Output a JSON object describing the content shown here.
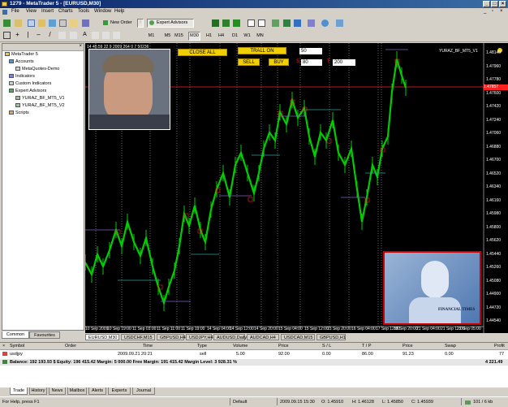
{
  "window": {
    "title": "1279 - MetaTrader 5 - [EURUSD,M30]"
  },
  "menu": [
    "File",
    "View",
    "Insert",
    "Charts",
    "Tools",
    "Window",
    "Help"
  ],
  "toolbar": {
    "new_order": "New Order",
    "expert_advisors": "Expert Advisors"
  },
  "timeframes": [
    "M1",
    "M5",
    "M15",
    "M30",
    "H1",
    "H4",
    "D1",
    "W1",
    "MN"
  ],
  "timeframe_active": "M30",
  "navigator": {
    "root": "MetaTrader 5",
    "items": [
      "Accounts",
      "MetaQuotes-Demo",
      "Indicators",
      "Custom Indicators",
      "Expert Advisors",
      "YURAZ_BF_MT5_V1",
      "YURAZ_BF_MT5_V2",
      "Scripts"
    ],
    "tabs": [
      "Common",
      "Favourites"
    ]
  },
  "chart": {
    "info": "14 40.59 22 9 2009 264 0 7 50236",
    "ea_label": "YURAZ_BF_MT5_V1",
    "close_all": "CLOSE ALL",
    "trall_on": "TRALL ON",
    "trall_value": "50",
    "sell": "SELL",
    "buy": "BUY",
    "s_label": "S",
    "s_value": "80",
    "t_label": "T",
    "t_value": "200",
    "current_price": "1.47857",
    "price_axis": [
      "1.48140",
      "1.47960",
      "1.47780",
      "1.47600",
      "1.47420",
      "1.47240",
      "1.47060",
      "1.46880",
      "1.46700",
      "1.46520",
      "1.46340",
      "1.46160",
      "1.45980",
      "1.45800",
      "1.45620",
      "1.45440",
      "1.45260",
      "1.45080",
      "1.44900",
      "1.44720",
      "1.44540"
    ],
    "time_axis": [
      "10 Sep 2009",
      "10 Sep 19:00",
      "11 Sep 03:00",
      "11 Sep 11:00",
      "11 Sep 19:00",
      "14 Sep 04:00",
      "14 Sep 12:00",
      "14 Sep 20:00",
      "15 Sep 04:00",
      "15 Sep 12:00",
      "15 Sep 20:00",
      "16 Sep 04:00",
      "17 Sep 12:00",
      "18 Sep 20:00",
      "21 Sep 04:00",
      "21 Sep 12:00",
      "22 Sep 05:00"
    ],
    "ad_text": "FINANCIAL TIMES",
    "colors": {
      "background": "#000000",
      "candle": "#00cc00",
      "level_line": "#ff2020",
      "grid": "#ffffff",
      "button": "#f0d000",
      "ad_border": "#cc0000"
    }
  },
  "symbol_tabs": [
    "EURUSD,M30",
    "USDCHF,M15",
    "GBPUSD,H4",
    "USDJPY,H4",
    "AUDUSD,Daily",
    "AUDCAD,H4",
    "USDCAD,M15",
    "GBPUSD,H1"
  ],
  "symbol_tab_active": "EURUSD,M30",
  "terminal": {
    "headers": [
      "Symbol",
      "Order",
      "Time",
      "Type",
      "Volume",
      "Price",
      "S / L",
      "T / P",
      "Price",
      "Swap",
      "Profit"
    ],
    "row": {
      "symbol": "usdjpy",
      "order": "",
      "time": "2009.09.21 20:21",
      "type": "sell",
      "volume": "5.00",
      "price": "92.00",
      "sl": "0.00",
      "tp": "86.00",
      "price2": "91.23",
      "swap": "0.00",
      "profit": "77"
    },
    "balance_line": "Balance: 192 193.93 $  Equity: 196 415.42  Margin: 5 000.00  Free Margin: 191 415.42  Margin Level: 3 928.31 %",
    "balance_total": "4 221.49",
    "tabs": [
      "Trade",
      "History",
      "News",
      "Mailbox",
      "Alerts",
      "Experts",
      "Journal"
    ]
  },
  "status": {
    "help": "For Help, press F1",
    "profile": "Default",
    "datetime": "2009.09.15 15:30",
    "open": "O: 1.45910",
    "high": "H: 1.46128",
    "low": "L: 1.45850",
    "close": "C: 1.45939",
    "traffic": "101 / 6 kb"
  }
}
